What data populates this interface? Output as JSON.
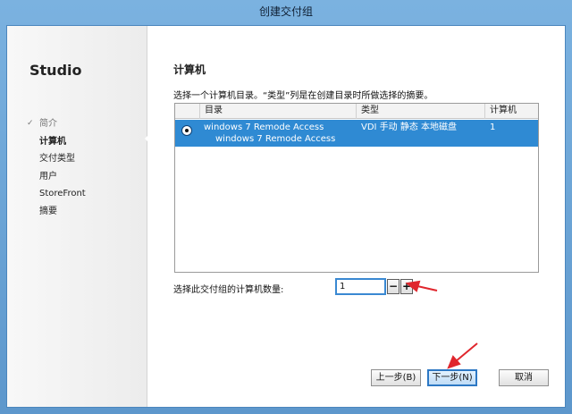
{
  "window": {
    "title": "创建交付组"
  },
  "sidebar": {
    "brand": "Studio",
    "done_mark": "✓",
    "steps": [
      {
        "label": "简介",
        "state": "done"
      },
      {
        "label": "计算机",
        "state": "current"
      },
      {
        "label": "交付类型",
        "state": "pending"
      },
      {
        "label": "用户",
        "state": "pending"
      },
      {
        "label": "StoreFront",
        "state": "pending"
      },
      {
        "label": "摘要",
        "state": "pending"
      }
    ]
  },
  "main": {
    "heading": "计算机",
    "description": "选择一个计算机目录。“类型”列是在创建目录时所做选择的摘要。",
    "table": {
      "columns": [
        "目录",
        "类型",
        "计算机"
      ],
      "rows": [
        {
          "catalog": "windows 7 Remode Access",
          "catalog_sub": "windows 7 Remode Access",
          "type": "VDI 手动 静态 本地磁盘",
          "count": "1",
          "selected": true
        }
      ]
    },
    "machine_count": {
      "label": "选择此交付组的计算机数量:",
      "value": "1",
      "minus": "−",
      "plus": "+"
    }
  },
  "footer": {
    "back": "上一步(B)",
    "next": "下一步(N)",
    "cancel": "取消"
  },
  "colors": {
    "selection": "#2f8ad3",
    "annotation_arrow": "#e0262d"
  }
}
